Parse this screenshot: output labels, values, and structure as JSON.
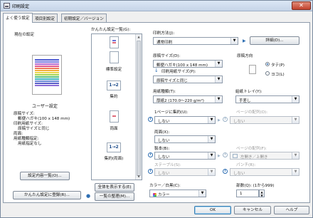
{
  "window": {
    "title": "印刷設定",
    "close_glyph": "✕"
  },
  "tabs": [
    {
      "label": "よく使う設定"
    },
    {
      "label": "項目別設定"
    },
    {
      "label": "初期設定／バージョン"
    }
  ],
  "current": {
    "heading": "現在の設定",
    "preset_name": "ユーザー設定",
    "summary": [
      "原稿サイズ:",
      "郵便ハガキ(100 x 148 mm)",
      "印刷用紙サイズ:",
      "原稿サイズと同じ",
      "両面:",
      "用紙種類指定:",
      "用紙指定なし"
    ],
    "list_button": "設定内容一覧(O)...",
    "register_button": "かんたん設定に登録(R)..."
  },
  "presets": {
    "label": "かんたん設定一覧(G):",
    "items": [
      {
        "label": "",
        "thumb": ""
      },
      {
        "label": "標準設定",
        "thumb": ""
      },
      {
        "label": "集約",
        "thumb": "1→2"
      },
      {
        "label": "両面",
        "thumb": ""
      },
      {
        "label": "集約(両面)",
        "thumb": "1→2"
      }
    ],
    "scroll_up": "▲",
    "scroll_down": "▼",
    "show_all_button": "全体を表示する(E)",
    "organize_button": "一覧の整理(M)..."
  },
  "print_method": {
    "label": "印刷方法(J):",
    "value": "通常印刷",
    "details_button": "詳細(D)..."
  },
  "original_size": {
    "label": "原稿サイズ(D):",
    "value": "郵便ハガキ(100 x 148 mm)"
  },
  "paper_size": {
    "label": "印刷用紙サイズ(P):",
    "value": "原稿サイズと同じ"
  },
  "orientation": {
    "label": "原稿方向",
    "options": [
      "タテ(P)",
      "ヨコ(L)"
    ]
  },
  "paper_type": {
    "label": "用紙種類(T):",
    "value": "厚紙2 (170.0～220 g/m²)"
  },
  "tray": {
    "label": "給紙トレイ(Y):",
    "value": "手差し"
  },
  "nup": {
    "label": "1ページに集約(U):",
    "value": "しない",
    "order_label": "ページの配列(O):",
    "order_value": "しない"
  },
  "duplex": {
    "label": "両面(X):",
    "value": "しない"
  },
  "binding": {
    "label": "製本(B):",
    "value": "しない",
    "order_label": "ページの配列(F):",
    "order_value": "左開き／上開き"
  },
  "staple": {
    "label": "ステープル(S):",
    "value": "しない"
  },
  "punch": {
    "label": "パンチ(R):",
    "value": "しない"
  },
  "color": {
    "label": "カラー／白黒(C):",
    "value": "カラー"
  },
  "copies": {
    "label": "部数(Q): (1から999)",
    "value": "1"
  },
  "footer": {
    "ok": "OK",
    "cancel": "キャンセル",
    "help": "ヘルプ"
  },
  "icons": {
    "arrow_down": "▼",
    "arrow_small": "▾",
    "info": "i",
    "play": "▶",
    "down_guide": "↓",
    "spin_up": "▲",
    "spin_down": "▼"
  },
  "colors": {
    "accent": "#2f6fb3",
    "panel_bg": "#ffffff",
    "window_bg": "#f0f0f0"
  }
}
